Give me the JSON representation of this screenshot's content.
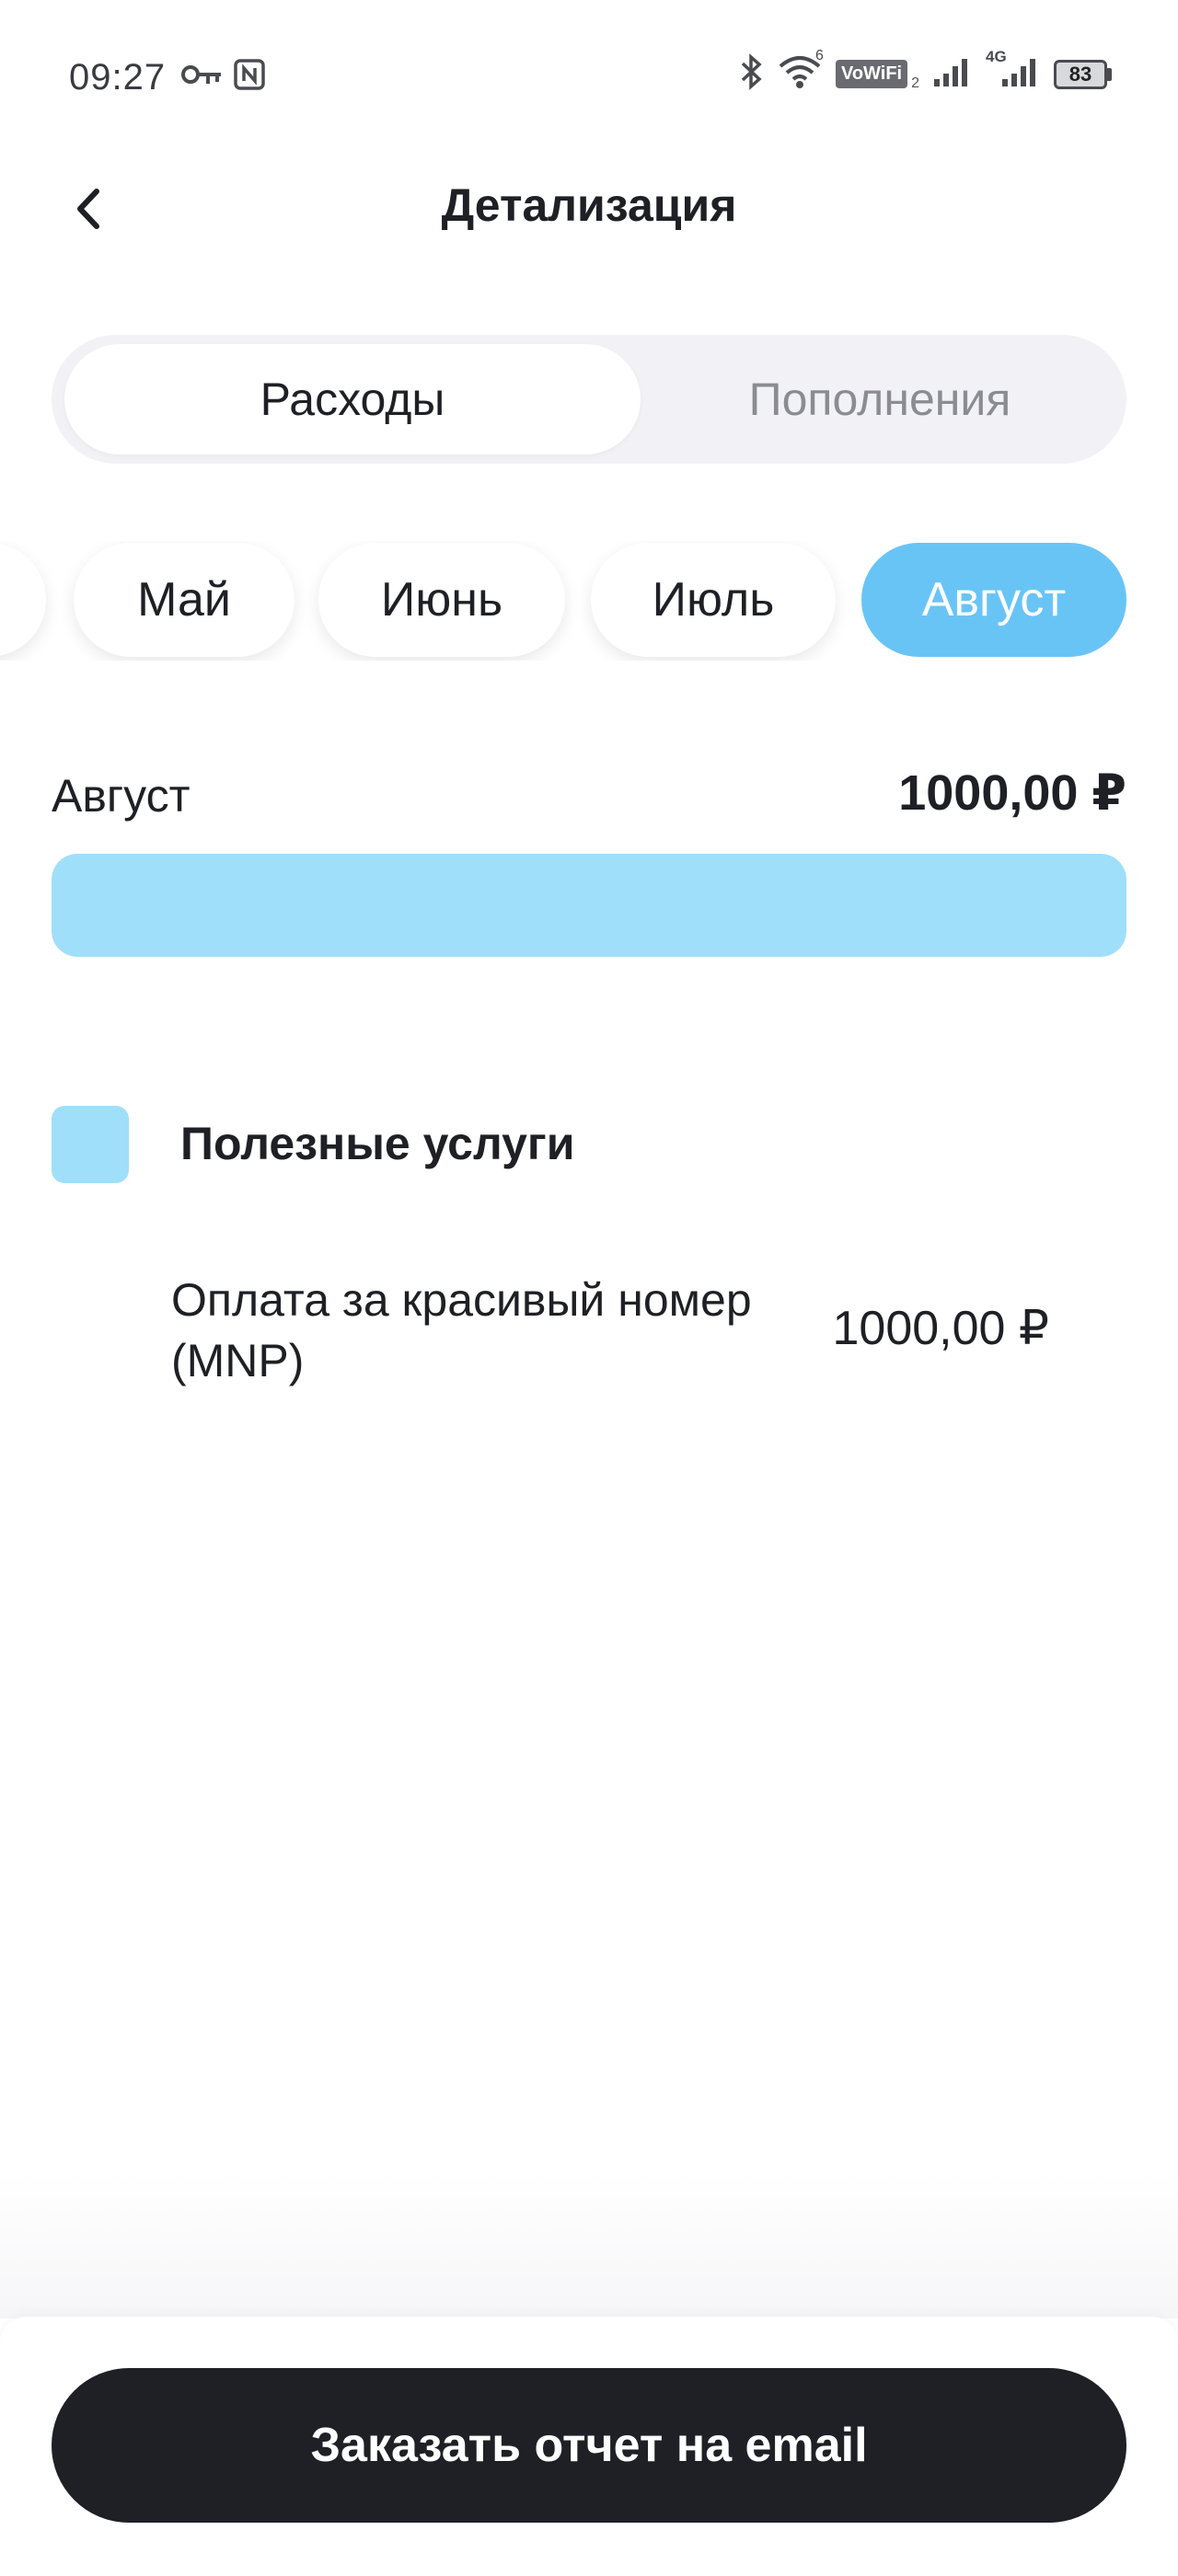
{
  "status_bar": {
    "time": "09:27",
    "vowifi_label": "VoWiFi",
    "vowifi_sub": "2",
    "network_label": "4G",
    "wifi_label": "6",
    "battery_level": "83",
    "icons": [
      "key-icon",
      "nfc-icon",
      "bluetooth-icon",
      "wifi-icon",
      "signal-icon",
      "signal-4g-icon",
      "battery-icon"
    ]
  },
  "header": {
    "title": "Детализация",
    "back_icon": "chevron-left-icon"
  },
  "segmented": {
    "tabs": [
      {
        "label": "Расходы",
        "active": true
      },
      {
        "label": "Пополнения",
        "active": false
      }
    ]
  },
  "months": {
    "items": [
      {
        "label": "",
        "active": false
      },
      {
        "label": "Май",
        "active": false
      },
      {
        "label": "Июнь",
        "active": false
      },
      {
        "label": "Июль",
        "active": false
      },
      {
        "label": "Август",
        "active": true
      }
    ]
  },
  "summary": {
    "month": "Август",
    "total": "1000,00 ₽",
    "bar_fraction": 1.0
  },
  "categories": [
    {
      "title": "Полезные услуги",
      "color": "#9fdffa",
      "items": [
        {
          "name": "Оплата за красивый номер (MNP)",
          "amount": "1000,00 ₽"
        }
      ]
    }
  ],
  "footer": {
    "order_button": "Заказать отчет на email"
  },
  "colors": {
    "accent": "#69c4f6",
    "category": "#9fdffa",
    "button_dark": "#1f2025"
  }
}
